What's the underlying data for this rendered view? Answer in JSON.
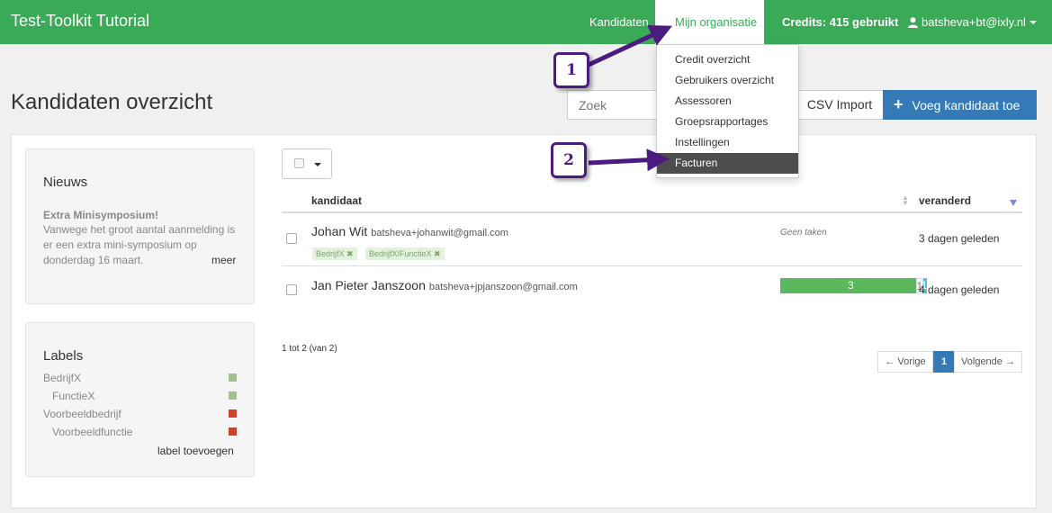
{
  "navbar": {
    "brand": "Test-Toolkit Tutorial",
    "kandidaten": "Kandidaten",
    "mijn_organisatie": "Mijn organisatie",
    "credits": "Credits: 415 gebruikt",
    "user": "batsheva+bt@ixly.nl"
  },
  "dropdown": {
    "items": [
      "Credit overzicht",
      "Gebruikers overzicht",
      "Assessoren",
      "Groepsrapportages",
      "Instellingen",
      "Facturen"
    ]
  },
  "page": {
    "title": "Kandidaten overzicht",
    "search_placeholder": "Zoek",
    "csv_import": "CSV Import",
    "add_candidate": "Voeg kandidaat toe"
  },
  "news": {
    "title": "Nieuws",
    "heading": "Extra Minisymposium!",
    "body": "Vanwege het groot aantal aanmelding is er een extra mini-symposium op donderdag 16 maart.",
    "more": "meer"
  },
  "labels": {
    "title": "Labels",
    "items": [
      {
        "name": "BedrijfX",
        "color": "#a4c093"
      },
      {
        "name": "FunctieX",
        "color": "#a4c093"
      },
      {
        "name": "Voorbeeldbedrijf",
        "color": "#d0432b"
      },
      {
        "name": "Voorbeeldfunctie",
        "color": "#d0432b"
      }
    ],
    "add": "label toevoegen"
  },
  "table": {
    "col_candidate": "kandidaat",
    "col_changed": "veranderd",
    "rows": [
      {
        "name": "Johan Wit",
        "email": "batsheva+johanwit@gmail.com",
        "tags": [
          "BedrijfX",
          "BedrijfX/FunctieX"
        ],
        "tasks": "Geen taken",
        "changed": "3 dagen geleden"
      },
      {
        "name": "Jan Pieter Janszoon",
        "email": "batsheva+jpjanszoon@gmail.com",
        "progress": {
          "done": 3,
          "started": 1,
          "open": 1
        },
        "changed": "4 dagen geleden"
      }
    ]
  },
  "pagination": {
    "info": "1 tot 2 (van 2)",
    "prev": "← Vorige",
    "page": "1",
    "next": "Volgende →"
  },
  "annotations": {
    "callout_1": "1",
    "callout_2": "2"
  },
  "colors": {
    "brand_green": "#3aaa57",
    "primary_blue": "#337ab7",
    "progress_done": "#5cb85c",
    "progress_started": "#5bc0de",
    "annotation_purple": "#4b1b7f"
  },
  "remove_tag_glyph": "✖",
  "tag_remove_icon": "close-icon"
}
